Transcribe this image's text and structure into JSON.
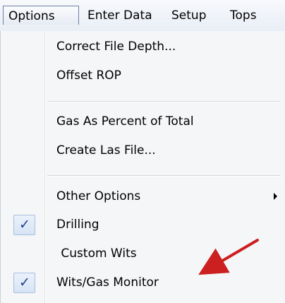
{
  "menubar": {
    "items": [
      {
        "label": "Options"
      },
      {
        "label": "Enter Data"
      },
      {
        "label": "Setup"
      },
      {
        "label": "Tops"
      }
    ]
  },
  "menu": {
    "items": [
      {
        "label": "Correct File Depth...",
        "checked": false
      },
      {
        "label": "Offset ROP",
        "checked": false
      },
      {
        "label": "Gas As Percent of Total",
        "checked": false
      },
      {
        "label": "Create  Las File...",
        "checked": false
      },
      {
        "label": "Other Options",
        "checked": false,
        "submenu": true
      },
      {
        "label": "Drilling",
        "checked": true
      },
      {
        "label": " Custom Wits",
        "checked": false
      },
      {
        "label": "Wits/Gas Monitor",
        "checked": true
      }
    ]
  },
  "check_glyph": "✓",
  "colors": {
    "arrow": "#cc1f1f",
    "check": "#1f3f8c"
  }
}
